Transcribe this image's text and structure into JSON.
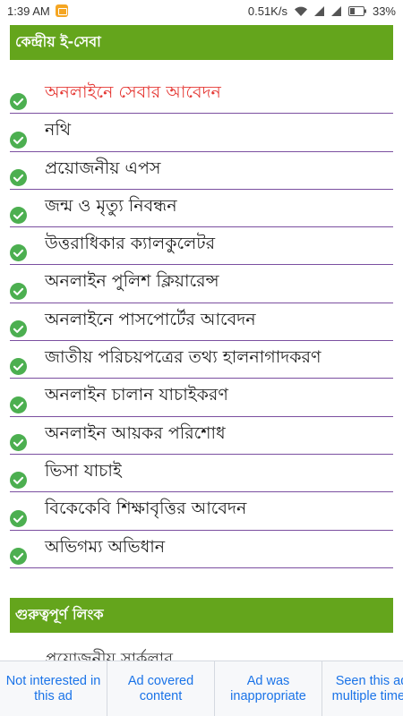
{
  "status_bar": {
    "time": "1:39 AM",
    "speed": "0.51K/s",
    "battery": "33%",
    "icons": [
      "notification-icon",
      "wifi-icon",
      "signal-icon",
      "signal-icon",
      "battery-icon"
    ]
  },
  "sections": [
    {
      "title": "কেন্দ্রীয় ই-সেবা"
    },
    {
      "title": "গুরুত্বপূর্ণ লিংক"
    }
  ],
  "services": [
    {
      "label": "অনলাইনে সেবার আবেদন",
      "active": true
    },
    {
      "label": "নথি"
    },
    {
      "label": "প্রয়োজনীয় এপস"
    },
    {
      "label": "জন্ম ও মৃত্যু নিবন্ধন"
    },
    {
      "label": "উত্তরাধিকার ক্যালকুলেটর"
    },
    {
      "label": "অনলাইন পুলিশ ক্লিয়ারেন্স"
    },
    {
      "label": "অনলাইনে পাসপোর্টের আবেদন"
    },
    {
      "label": "জাতীয় পরিচয়পত্রের তথ্য হালনাগাদকরণ"
    },
    {
      "label": "অনলাইন চালান যাচাইকরণ"
    },
    {
      "label": "অনলাইন আয়কর পরিশোধ"
    },
    {
      "label": "ভিসা যাচাই"
    },
    {
      "label": "বিকেকেবি শিক্ষাবৃত্তির আবেদন"
    },
    {
      "label": "অভিগম্য অভিধান"
    }
  ],
  "partial_item": "প্রয়োজনীয় সার্কুলার",
  "ad_feedback": {
    "options": [
      "Not interested in this ad",
      "Ad covered content",
      "Ad was inappropriate",
      "Seen this ad multiple times"
    ]
  },
  "colors": {
    "header_green": "#64a51c",
    "check_green": "#4caf50",
    "divider_purple": "#7b4fa0",
    "active_red": "#e53935",
    "ad_link_blue": "#1a73e8"
  }
}
